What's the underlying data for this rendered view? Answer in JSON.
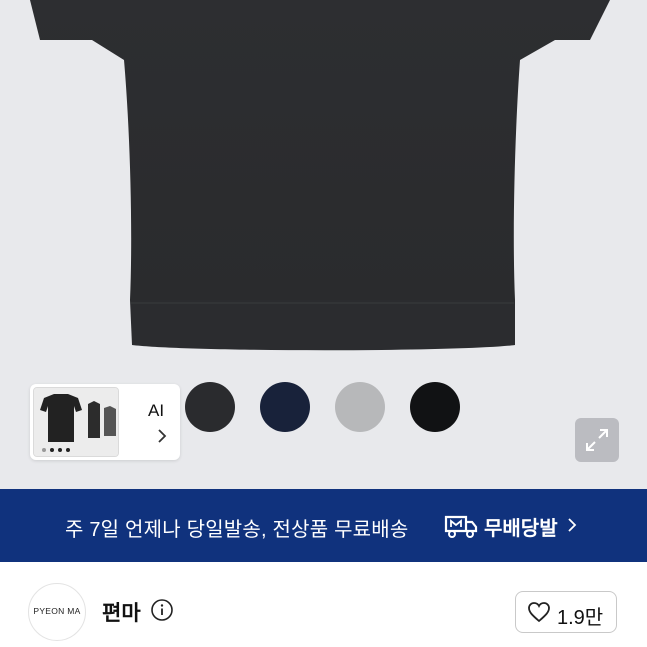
{
  "product": {
    "ai_label": "AI",
    "swatches": [
      "#2a2b2e",
      "#18223a",
      "#b7b8ba",
      "#111214"
    ]
  },
  "banner": {
    "text": "주 7일 언제나 당일발송, 전상품 무료배송",
    "brand": "무배당발",
    "background": "#10327d"
  },
  "store": {
    "avatar_text": "PYEON MA",
    "name": "편마",
    "like_count": "1.9만"
  },
  "icons": {
    "expand": "expand-icon",
    "info": "info-icon",
    "heart": "heart-icon",
    "chevron": "chevron-right-icon",
    "truck_logo": "delivery-truck-icon"
  }
}
